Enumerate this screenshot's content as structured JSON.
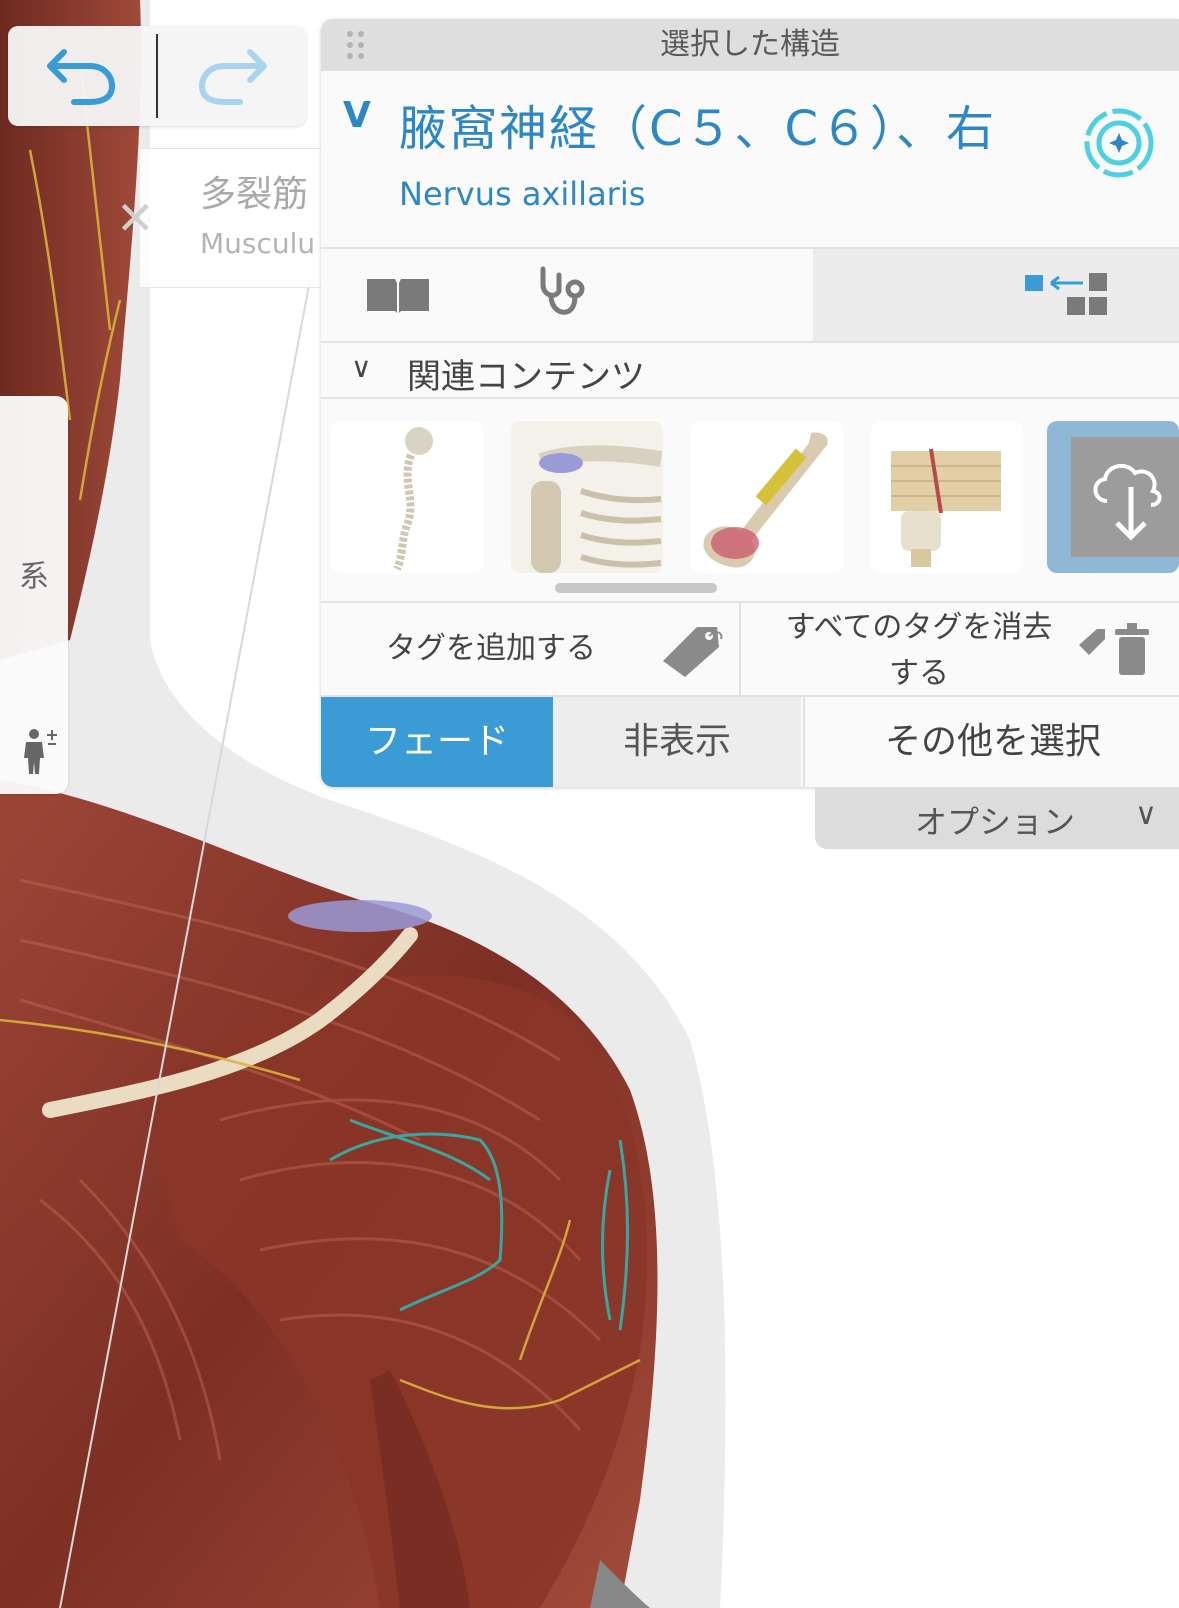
{
  "toolbar": {
    "undo_icon": "undo-arrow-icon",
    "redo_icon": "redo-arrow-icon"
  },
  "previous_selection": {
    "name_jp": "多裂筋",
    "name_latin": "Musculu"
  },
  "side_tab": {
    "label": "系",
    "figure_icon": "human-figure-plus-icon"
  },
  "panel": {
    "header_title": "選択した構造",
    "structure_name": "腋窩神経（C５、C６）、右",
    "structure_latin": "Nervus axillaris",
    "related_header": "関連コンテンツ",
    "tags": {
      "add_label": "タグを追加する",
      "clear_label_line1": "すべてのタグを消去",
      "clear_label_line2": "する"
    },
    "actions": {
      "fade": "フェード",
      "hide": "非表示",
      "select_other": "その他を選択"
    },
    "options_label": "オプション",
    "chevron": "∨"
  },
  "colors": {
    "accent": "#3a9bd5",
    "structure_text": "#2d87c3",
    "header_bg": "#dedede",
    "muscle": "#8b3a2c"
  }
}
